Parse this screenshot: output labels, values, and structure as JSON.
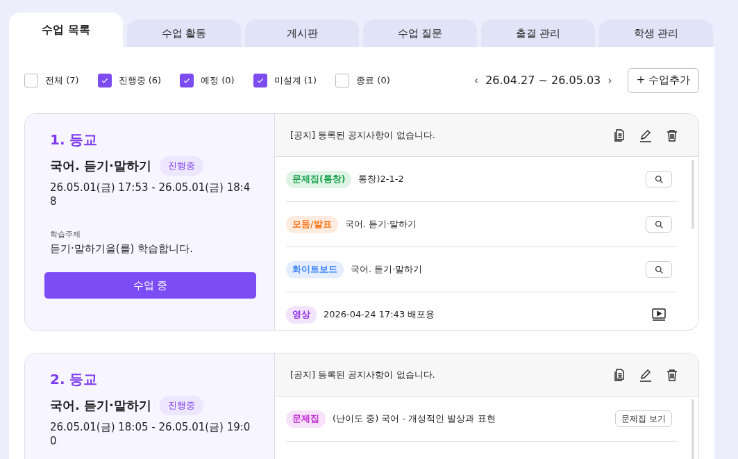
{
  "tabs": [
    {
      "label": "수업 목록",
      "selected": true
    },
    {
      "label": "수업 활동",
      "selected": false
    },
    {
      "label": "게시판",
      "selected": false
    },
    {
      "label": "수업 질문",
      "selected": false
    },
    {
      "label": "출결 관리",
      "selected": false
    },
    {
      "label": "학생 관리",
      "selected": false
    }
  ],
  "filters": [
    {
      "label": "전체 (7)",
      "checked": false
    },
    {
      "label": "진행중 (6)",
      "checked": true
    },
    {
      "label": "예정 (0)",
      "checked": true
    },
    {
      "label": "미설계 (1)",
      "checked": true
    },
    {
      "label": "종료 (0)",
      "checked": false
    }
  ],
  "date_range": {
    "prev": "‹",
    "range": "26.04.27 ~ 26.05.03",
    "next": "›"
  },
  "add_button": "+ 수업추가",
  "lessons": [
    {
      "title": "1. 등교",
      "subject": "국어. 듣기·말하기",
      "status": "진행중",
      "time": "26.05.01(금) 17:53 - 26.05.01(금) 18:48",
      "topic_label": "학습주제",
      "topic": "듣기·말하기을(를) 학습합니다.",
      "button": "수업 중",
      "notice": "[공지] 등록된 공지사항이 없습니다.",
      "activities": [
        {
          "tag": "문제집(통창)",
          "color": "#16a34a",
          "text": "통창)2-1-2",
          "kind": "search"
        },
        {
          "tag": "모둠/발표",
          "color": "#f97316",
          "text": "국어. 듣기·말하기",
          "kind": "search"
        },
        {
          "tag": "화이트보드",
          "color": "#3b82f6",
          "text": "국어. 듣기·말하기",
          "kind": "search"
        },
        {
          "tag": "영상",
          "color": "#9333ea",
          "text": "2026-04-24 17:43 배포용",
          "kind": "video"
        }
      ]
    },
    {
      "title": "2. 등교",
      "subject": "국어. 듣기·말하기",
      "status": "진행중",
      "time": "26.05.01(금) 18:05 - 26.05.01(금) 19:00",
      "notice": "[공지] 등록된 공지사항이 없습니다.",
      "activities": [
        {
          "tag": "문제집",
          "color": "#c026d3",
          "text": "(난이도 중) 국어 - 개성적인 발상과 표현",
          "kind": "text",
          "action": "문제집 보기"
        }
      ]
    }
  ]
}
